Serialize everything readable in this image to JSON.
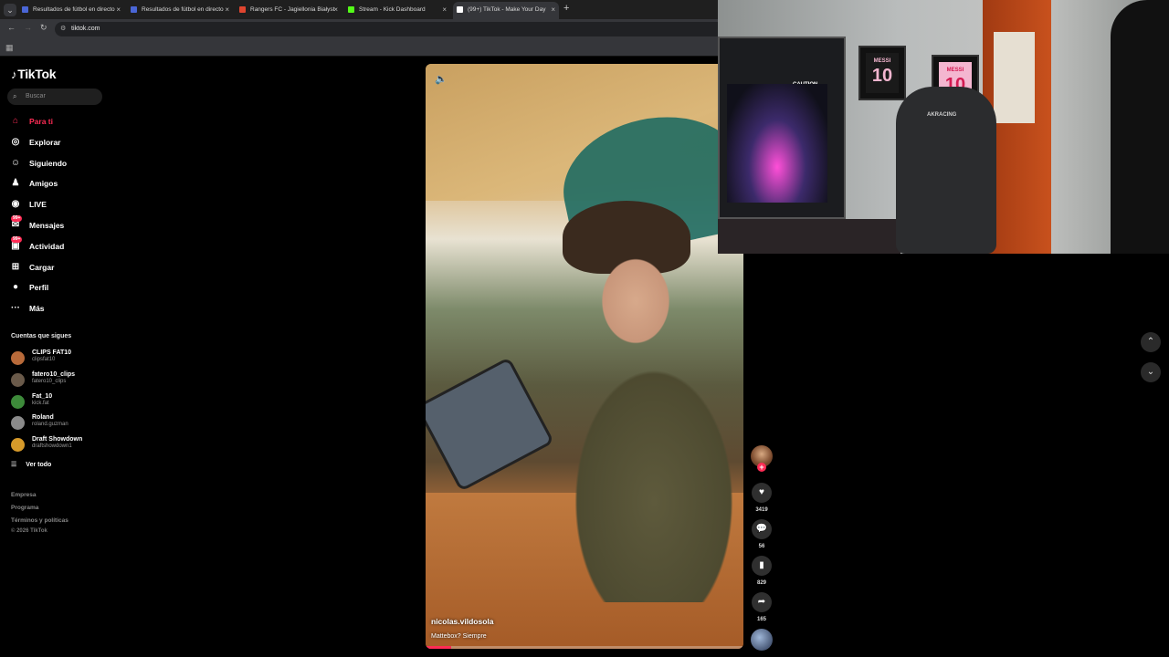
{
  "browser": {
    "tabs": [
      {
        "title": "Resultados de fútbol en directo",
        "color": "#4a66d6",
        "active": false
      },
      {
        "title": "Resultados de fútbol en directo",
        "color": "#4a66d6",
        "active": false
      },
      {
        "title": "Rangers FC - Jagiellonia Białyst",
        "color": "#e0452f",
        "active": false
      },
      {
        "title": "Stream - Kick Dashboard",
        "color": "#53fc18",
        "active": false
      },
      {
        "title": "(99+) TikTok - Make Your Day",
        "color": "#ffffff",
        "active": true
      }
    ],
    "url": "tiktok.com",
    "newtab_symbol": "+",
    "close_symbol": "×"
  },
  "sidebar": {
    "logo": "TikTok",
    "search_placeholder": "Buscar",
    "nav": [
      {
        "label": "Para ti",
        "icon": "home-icon",
        "glyph": "⌂",
        "active": true
      },
      {
        "label": "Explorar",
        "icon": "compass-icon",
        "glyph": "◎",
        "active": false
      },
      {
        "label": "Siguiendo",
        "icon": "following-icon",
        "glyph": "☺",
        "active": false
      },
      {
        "label": "Amigos",
        "icon": "friends-icon",
        "glyph": "♟",
        "active": false
      },
      {
        "label": "LIVE",
        "icon": "live-icon",
        "glyph": "◉",
        "active": false
      },
      {
        "label": "Mensajes",
        "icon": "messages-icon",
        "glyph": "✉",
        "active": false,
        "badge": "99+"
      },
      {
        "label": "Actividad",
        "icon": "activity-icon",
        "glyph": "▣",
        "active": false,
        "badge": "99+"
      },
      {
        "label": "Cargar",
        "icon": "upload-icon",
        "glyph": "⊞",
        "active": false
      },
      {
        "label": "Perfil",
        "icon": "profile-icon",
        "glyph": "●",
        "active": false
      },
      {
        "label": "Más",
        "icon": "more-icon",
        "glyph": "···",
        "active": false
      }
    ],
    "following_title": "Cuentas que sigues",
    "following": [
      {
        "name": "CLIPS FAT10",
        "handle": "clipsfat10",
        "color": "#b86a3a"
      },
      {
        "name": "fatero10_clips",
        "handle": "fatero10_clips",
        "color": "#6a5a4a"
      },
      {
        "name": "Fat_10",
        "handle": "kick.fat",
        "color": "#3d8a3a"
      },
      {
        "name": "Roland",
        "handle": "roland.guzman",
        "color": "#8a8a8a"
      },
      {
        "name": "Draft Showdown",
        "handle": "draftshowdown1",
        "color": "#d69a2a"
      }
    ],
    "see_all": "Ver todo",
    "footer": [
      "Empresa",
      "Programa",
      "Términos y políticas"
    ],
    "copyright": "© 2026 TikTok"
  },
  "video": {
    "author": "nicolas.vildosola",
    "caption": "Mattebox? Siempre",
    "progress": 0.08
  },
  "actions": {
    "likes": "3419",
    "comments": "56",
    "saves": "829",
    "shares": "165"
  },
  "webcam": {
    "frame1_name": "MESSI",
    "frame1_number": "10",
    "frame2_name": "MESSI",
    "frame2_number": "10",
    "pc_label": "CAUTION",
    "chair_brand": "AKRACING"
  }
}
